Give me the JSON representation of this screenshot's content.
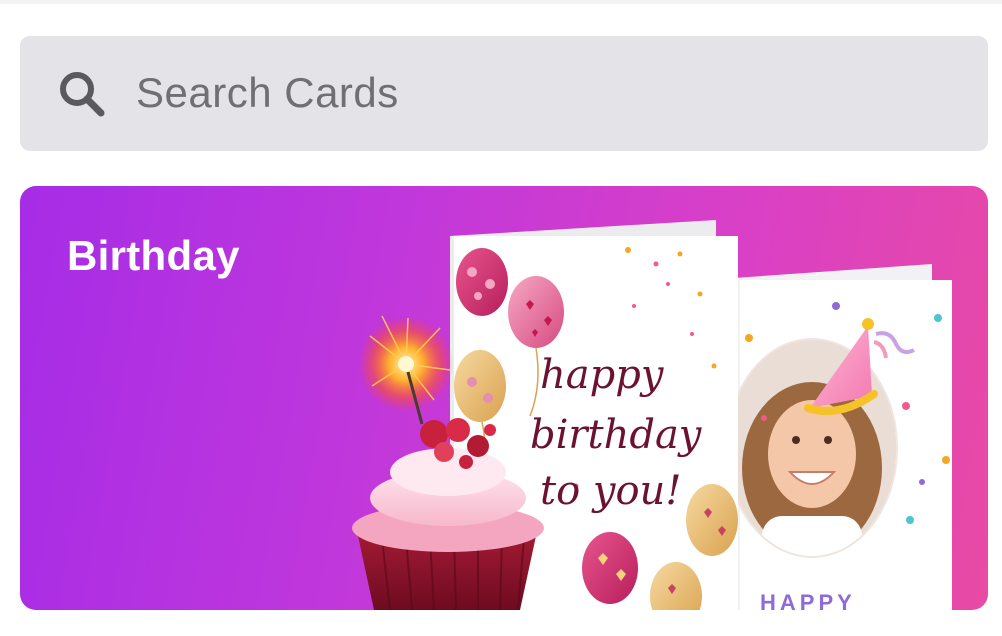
{
  "search": {
    "placeholder": "Search Cards",
    "icon": "search-icon"
  },
  "categories": [
    {
      "title": "Birthday",
      "card_text": {
        "line1": "happy",
        "line2": "birthday",
        "line3": "to you!",
        "front_card_text": "HAPPY"
      }
    }
  ],
  "colors": {
    "search_bg": "#e4e4e8",
    "banner_gradient_start": "#a62ce6",
    "banner_gradient_end": "#e84aa4",
    "title_color": "#ffffff",
    "script_color": "#6b1230"
  }
}
